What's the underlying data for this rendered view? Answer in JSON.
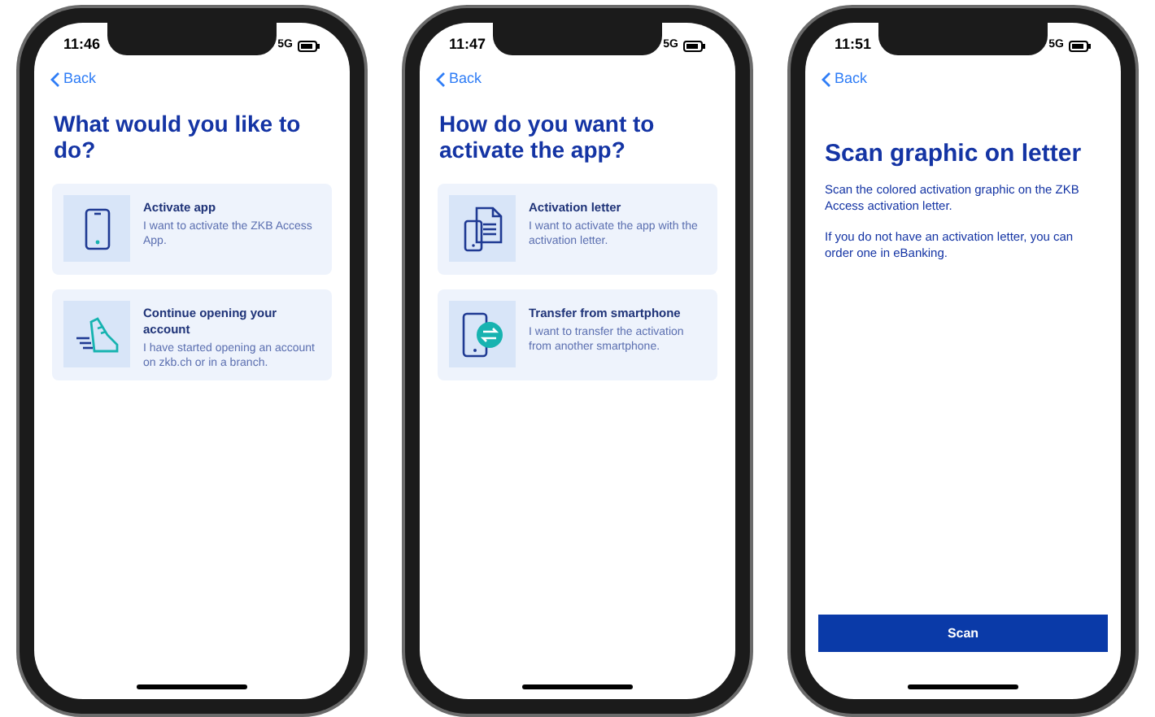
{
  "phones": [
    {
      "time": "11:46",
      "network": "5G",
      "back": "Back",
      "title": "What would you like to do?",
      "options": [
        {
          "kind": "phone",
          "title": "Activate app",
          "text": "I want to activate the ZKB Access App."
        },
        {
          "kind": "shoe",
          "title": "Continue opening your account",
          "text": "I have started opening an account on zkb.ch or in a branch."
        }
      ]
    },
    {
      "time": "11:47",
      "network": "5G",
      "back": "Back",
      "title": "How do you want to activate the app?",
      "options": [
        {
          "kind": "letter",
          "title": "Activation letter",
          "text": "I want to activate the app with the activation letter."
        },
        {
          "kind": "transfer",
          "title": "Transfer from smartphone",
          "text": "I want to transfer the activation from another smartphone."
        }
      ]
    },
    {
      "time": "11:51",
      "network": "5G",
      "back": "Back",
      "title": "Scan graphic on letter",
      "paragraphs": [
        "Scan the colored activation graphic on the ZKB Access activation letter.",
        "If you do not have an activation letter, you can order one in eBanking."
      ],
      "button": "Scan"
    }
  ]
}
